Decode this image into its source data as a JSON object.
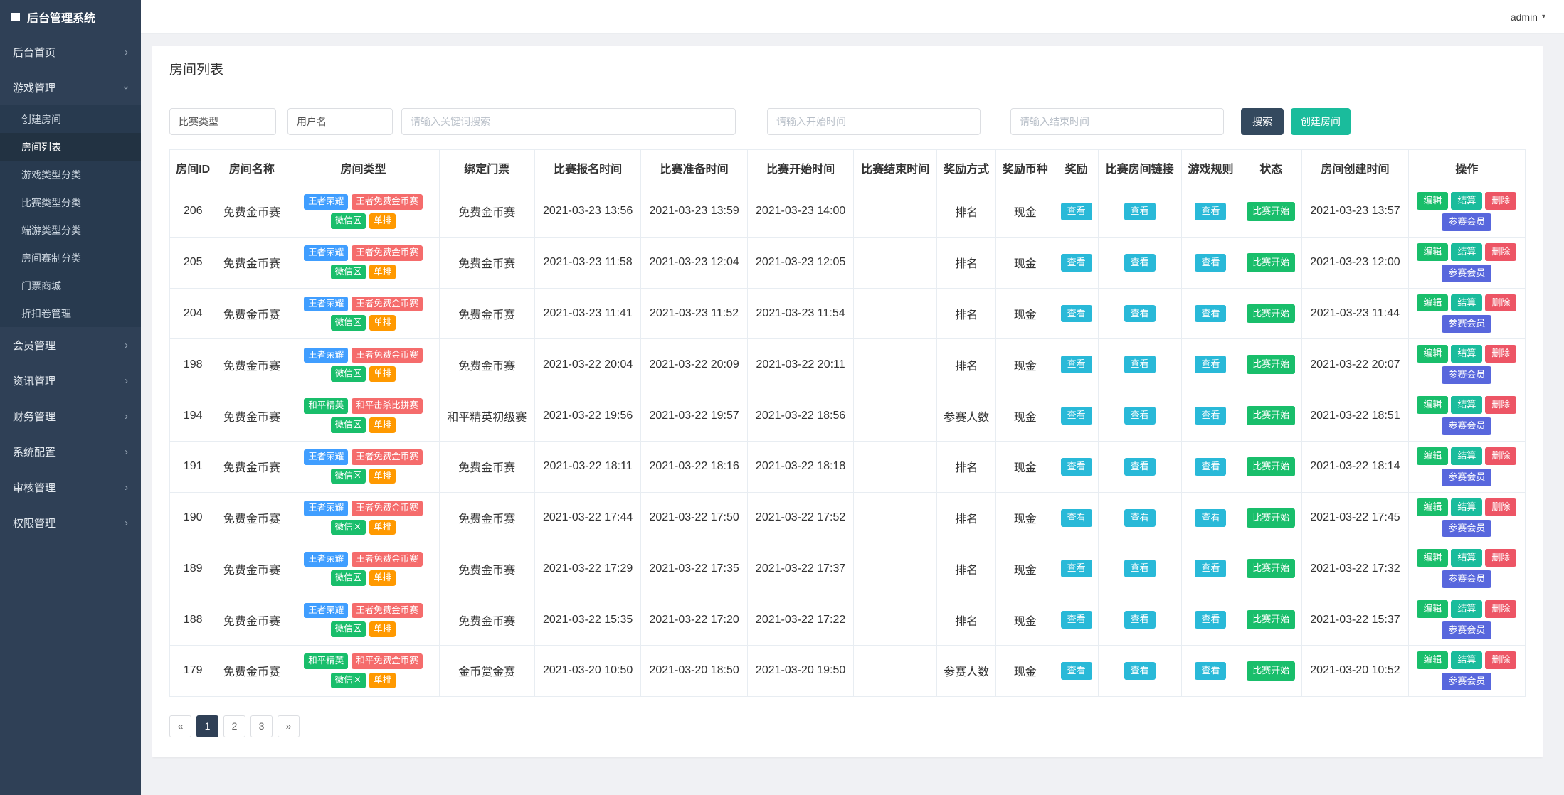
{
  "app": {
    "title": "后台管理系统",
    "user": "admin",
    "caret": "▾"
  },
  "sidebar": {
    "active": "房间列表",
    "items": [
      {
        "label": "后台首页"
      },
      {
        "label": "游戏管理",
        "expanded": true,
        "children": [
          "创建房间",
          "房间列表",
          "游戏类型分类",
          "比赛类型分类",
          "端游类型分类",
          "房间赛制分类",
          "门票商城",
          "折扣卷管理"
        ]
      },
      {
        "label": "会员管理"
      },
      {
        "label": "资讯管理"
      },
      {
        "label": "财务管理"
      },
      {
        "label": "系统配置"
      },
      {
        "label": "审核管理"
      },
      {
        "label": "权限管理"
      }
    ]
  },
  "page": {
    "title": "房间列表"
  },
  "filters": {
    "match_type": "比赛类型",
    "username": "用户名",
    "keyword_placeholder": "请输入关键词搜索",
    "start_placeholder": "请输入开始时间",
    "end_placeholder": "请输入结束时间",
    "search_label": "搜索",
    "create_label": "创建房间"
  },
  "colors": {
    "blue": "#409eff",
    "red": "#f56c6c",
    "green": "#19be6b",
    "orange": "#ff9900",
    "view": "#29b9d8",
    "status": "#19be6b",
    "edit": "#19be6b",
    "settle": "#1abc9c",
    "delete": "#ed5565",
    "members": "#5867dd",
    "search": "#34495e",
    "create": "#1abc9c"
  },
  "row_actions": {
    "status": "比赛开始",
    "edit": "编辑",
    "settle": "结算",
    "delete": "删除",
    "members": "参赛会员"
  },
  "table": {
    "headers": [
      "房间ID",
      "房间名称",
      "房间类型",
      "绑定门票",
      "比赛报名时间",
      "比赛准备时间",
      "比赛开始时间",
      "比赛结束时间",
      "奖励方式",
      "奖励币种",
      "奖励",
      "比赛房间链接",
      "游戏规则",
      "状态",
      "房间创建时间",
      "操作"
    ],
    "view_label": "查看",
    "rows": [
      {
        "id": "206",
        "name": "免费金币赛",
        "tags": [
          {
            "text": "王者荣耀",
            "color": "blue"
          },
          {
            "text": "王者免费金币赛",
            "color": "red"
          },
          {
            "text": "微信区",
            "color": "green"
          },
          {
            "text": "单排",
            "color": "orange"
          }
        ],
        "ticket": "免费金币赛",
        "signup": "2021-03-23 13:56",
        "ready": "2021-03-23 13:59",
        "start": "2021-03-23 14:00",
        "end": "",
        "method": "排名",
        "currency": "现金",
        "created": "2021-03-23 13:57"
      },
      {
        "id": "205",
        "name": "免费金币赛",
        "tags": [
          {
            "text": "王者荣耀",
            "color": "blue"
          },
          {
            "text": "王者免费金币赛",
            "color": "red"
          },
          {
            "text": "微信区",
            "color": "green"
          },
          {
            "text": "单排",
            "color": "orange"
          }
        ],
        "ticket": "免费金币赛",
        "signup": "2021-03-23 11:58",
        "ready": "2021-03-23 12:04",
        "start": "2021-03-23 12:05",
        "end": "",
        "method": "排名",
        "currency": "现金",
        "created": "2021-03-23 12:00"
      },
      {
        "id": "204",
        "name": "免费金币赛",
        "tags": [
          {
            "text": "王者荣耀",
            "color": "blue"
          },
          {
            "text": "王者免费金币赛",
            "color": "red"
          },
          {
            "text": "微信区",
            "color": "green"
          },
          {
            "text": "单排",
            "color": "orange"
          }
        ],
        "ticket": "免费金币赛",
        "signup": "2021-03-23 11:41",
        "ready": "2021-03-23 11:52",
        "start": "2021-03-23 11:54",
        "end": "",
        "method": "排名",
        "currency": "现金",
        "created": "2021-03-23 11:44"
      },
      {
        "id": "198",
        "name": "免费金币赛",
        "tags": [
          {
            "text": "王者荣耀",
            "color": "blue"
          },
          {
            "text": "王者免费金币赛",
            "color": "red"
          },
          {
            "text": "微信区",
            "color": "green"
          },
          {
            "text": "单排",
            "color": "orange"
          }
        ],
        "ticket": "免费金币赛",
        "signup": "2021-03-22 20:04",
        "ready": "2021-03-22 20:09",
        "start": "2021-03-22 20:11",
        "end": "",
        "method": "排名",
        "currency": "现金",
        "created": "2021-03-22 20:07"
      },
      {
        "id": "194",
        "name": "免费金币赛",
        "tags": [
          {
            "text": "和平精英",
            "color": "green"
          },
          {
            "text": "和平击杀比拼赛",
            "color": "red"
          },
          {
            "text": "微信区",
            "color": "green"
          },
          {
            "text": "单排",
            "color": "orange"
          }
        ],
        "ticket": "和平精英初级赛",
        "signup": "2021-03-22 19:56",
        "ready": "2021-03-22 19:57",
        "start": "2021-03-22 18:56",
        "end": "",
        "method": "参赛人数",
        "currency": "现金",
        "created": "2021-03-22 18:51"
      },
      {
        "id": "191",
        "name": "免费金币赛",
        "tags": [
          {
            "text": "王者荣耀",
            "color": "blue"
          },
          {
            "text": "王者免费金币赛",
            "color": "red"
          },
          {
            "text": "微信区",
            "color": "green"
          },
          {
            "text": "单排",
            "color": "orange"
          }
        ],
        "ticket": "免费金币赛",
        "signup": "2021-03-22 18:11",
        "ready": "2021-03-22 18:16",
        "start": "2021-03-22 18:18",
        "end": "",
        "method": "排名",
        "currency": "现金",
        "created": "2021-03-22 18:14"
      },
      {
        "id": "190",
        "name": "免费金币赛",
        "tags": [
          {
            "text": "王者荣耀",
            "color": "blue"
          },
          {
            "text": "王者免费金币赛",
            "color": "red"
          },
          {
            "text": "微信区",
            "color": "green"
          },
          {
            "text": "单排",
            "color": "orange"
          }
        ],
        "ticket": "免费金币赛",
        "signup": "2021-03-22 17:44",
        "ready": "2021-03-22 17:50",
        "start": "2021-03-22 17:52",
        "end": "",
        "method": "排名",
        "currency": "现金",
        "created": "2021-03-22 17:45"
      },
      {
        "id": "189",
        "name": "免费金币赛",
        "tags": [
          {
            "text": "王者荣耀",
            "color": "blue"
          },
          {
            "text": "王者免费金币赛",
            "color": "red"
          },
          {
            "text": "微信区",
            "color": "green"
          },
          {
            "text": "单排",
            "color": "orange"
          }
        ],
        "ticket": "免费金币赛",
        "signup": "2021-03-22 17:29",
        "ready": "2021-03-22 17:35",
        "start": "2021-03-22 17:37",
        "end": "",
        "method": "排名",
        "currency": "现金",
        "created": "2021-03-22 17:32"
      },
      {
        "id": "188",
        "name": "免费金币赛",
        "tags": [
          {
            "text": "王者荣耀",
            "color": "blue"
          },
          {
            "text": "王者免费金币赛",
            "color": "red"
          },
          {
            "text": "微信区",
            "color": "green"
          },
          {
            "text": "单排",
            "color": "orange"
          }
        ],
        "ticket": "免费金币赛",
        "signup": "2021-03-22 15:35",
        "ready": "2021-03-22 17:20",
        "start": "2021-03-22 17:22",
        "end": "",
        "method": "排名",
        "currency": "现金",
        "created": "2021-03-22 15:37"
      },
      {
        "id": "179",
        "name": "免费金币赛",
        "tags": [
          {
            "text": "和平精英",
            "color": "green"
          },
          {
            "text": "和平免费金币赛",
            "color": "red"
          },
          {
            "text": "微信区",
            "color": "green"
          },
          {
            "text": "单排",
            "color": "orange"
          }
        ],
        "ticket": "金币赏金赛",
        "signup": "2021-03-20 10:50",
        "ready": "2021-03-20 18:50",
        "start": "2021-03-20 19:50",
        "end": "",
        "method": "参赛人数",
        "currency": "现金",
        "created": "2021-03-20 10:52"
      }
    ]
  },
  "pagination": {
    "prev": "«",
    "pages": [
      "1",
      "2",
      "3"
    ],
    "next": "»",
    "active": "1"
  }
}
